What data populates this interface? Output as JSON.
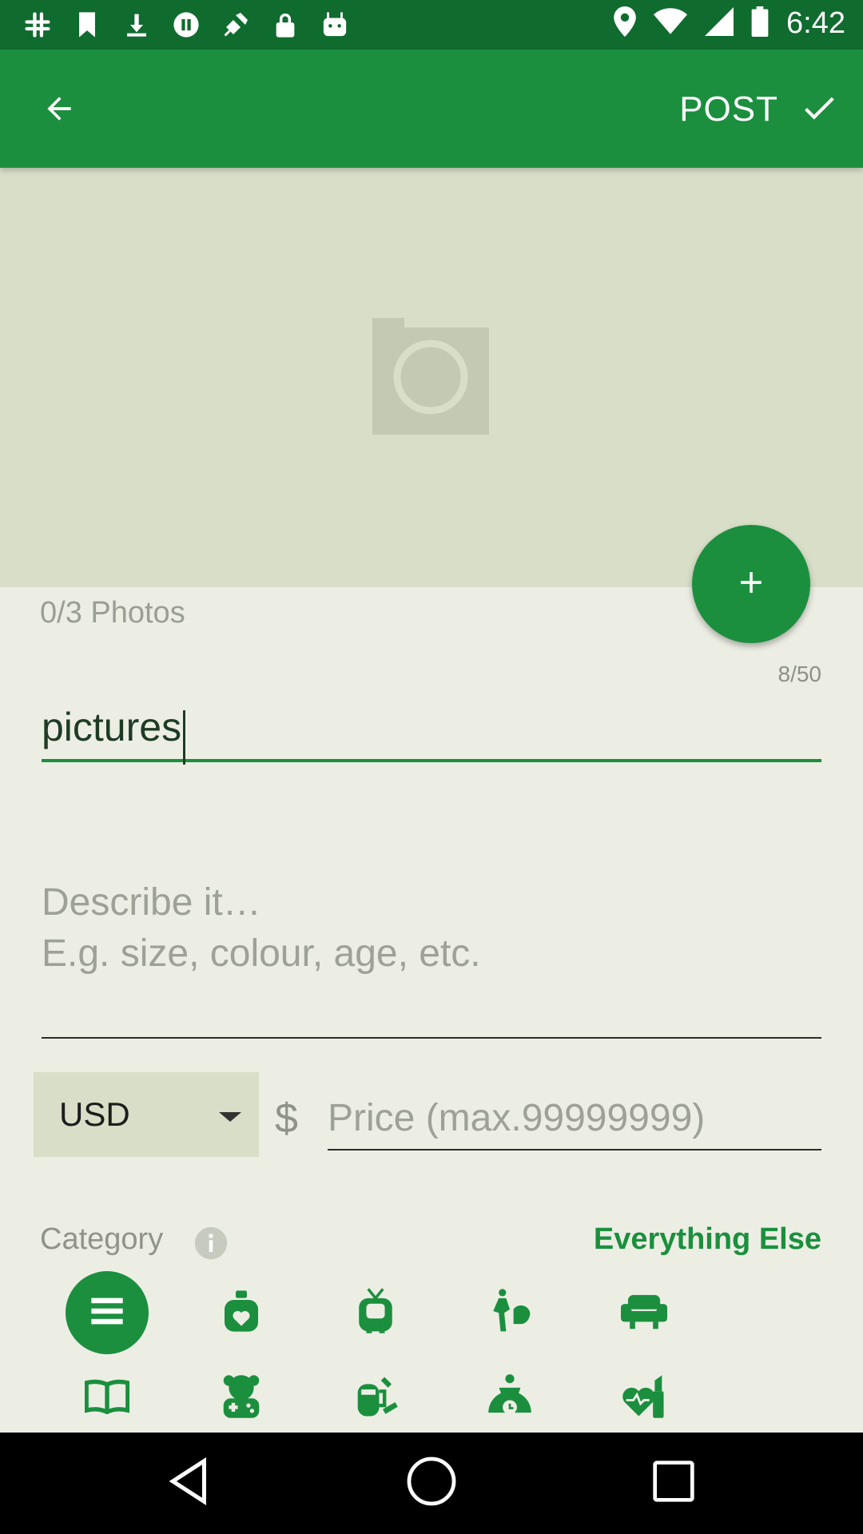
{
  "status_bar": {
    "time": "6:42",
    "icons": [
      "slack-icon",
      "bookmark-icon",
      "download-icon",
      "media-pause-icon",
      "fake-gps-icon",
      "lock-icon",
      "android-icon"
    ],
    "right_icons": [
      "location-icon",
      "wifi-icon",
      "signal-icon",
      "battery-icon"
    ]
  },
  "app_bar": {
    "back_icon": "arrow-left-icon",
    "post_label": "POST",
    "post_icon": "check-icon"
  },
  "photo_area": {
    "placeholder_icon": "camera-icon",
    "add_icon": "plus-icon",
    "photos_count": "0/3 Photos"
  },
  "title_field": {
    "counter": "8/50",
    "value": "pictures"
  },
  "description_field": {
    "placeholder_line1": "Describe it…",
    "placeholder_line2": "E.g. size, colour, age, etc."
  },
  "price": {
    "currency": "USD",
    "symbol": "$",
    "placeholder": "Price (max.99999999)"
  },
  "category": {
    "label": "Category",
    "info_icon": "info-icon",
    "selected_value": "Everything Else",
    "icons": [
      "everything-else-icon",
      "baby-bottle-icon",
      "electronics-icon",
      "fashion-icon",
      "furniture-icon",
      "books-icon",
      "toys-games-icon",
      "kitchen-icon",
      "services-icon",
      "health-beauty-icon"
    ]
  },
  "colors": {
    "primary": "#1b8f3e",
    "status_bar": "#0f6b2e",
    "background": "#eceee4",
    "photo_area": "#d8dec7"
  },
  "nav_bar": {
    "icons": [
      "back-triangle-icon",
      "home-circle-icon",
      "recents-square-icon"
    ]
  }
}
